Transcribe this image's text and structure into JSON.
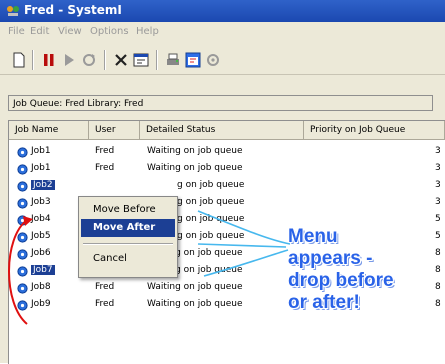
{
  "window": {
    "title": "Fred - SystemI"
  },
  "menubar": [
    "File",
    "Edit",
    "View",
    "Options",
    "Help"
  ],
  "toolbar": [
    "new-icon",
    "hold-icon",
    "release-icon",
    "move-icon",
    "delete-icon",
    "properties-icon",
    "printer-icon",
    "view-icon",
    "refresh-icon"
  ],
  "info": "Job Queue: Fred  Library: Fred",
  "table": {
    "headers": [
      "Job Name",
      "User",
      "Detailed Status",
      "Priority on Job Queue"
    ],
    "rows": [
      {
        "name": "Job1",
        "user": "Fred",
        "status": "Waiting on job queue",
        "priority": "3"
      },
      {
        "name": "Job1",
        "user": "Fred",
        "status": "Waiting on job queue",
        "priority": "3"
      },
      {
        "name": "Job2",
        "user": "",
        "status": "g on job queue",
        "priority": "3",
        "selected": true
      },
      {
        "name": "Job3",
        "user": "",
        "status": "g on job queue",
        "priority": "3"
      },
      {
        "name": "Job4",
        "user": "",
        "status": "g on job queue",
        "priority": "5"
      },
      {
        "name": "Job5",
        "user": "",
        "status": "g on job queue",
        "priority": "5"
      },
      {
        "name": "Job6",
        "user": "Fred",
        "status": "Waiting on job queue",
        "priority": "8"
      },
      {
        "name": "Job7",
        "user": "Fred",
        "status": "Waiting on job queue",
        "priority": "8",
        "selected": true
      },
      {
        "name": "Job8",
        "user": "Fred",
        "status": "Waiting on job queue",
        "priority": "8"
      },
      {
        "name": "Job9",
        "user": "Fred",
        "status": "Waiting on job queue",
        "priority": "8"
      }
    ]
  },
  "context_menu": {
    "move_before": "Move Before",
    "move_after": "Move After",
    "cancel": "Cancel"
  },
  "callout": [
    "Menu",
    "appears -",
    "drop before",
    "or after!"
  ],
  "colors": {
    "title_bar": "#1b48b0",
    "selection": "#1c3f94",
    "callout_text": "#2a63e8",
    "drag_arrow": "#e01010"
  }
}
